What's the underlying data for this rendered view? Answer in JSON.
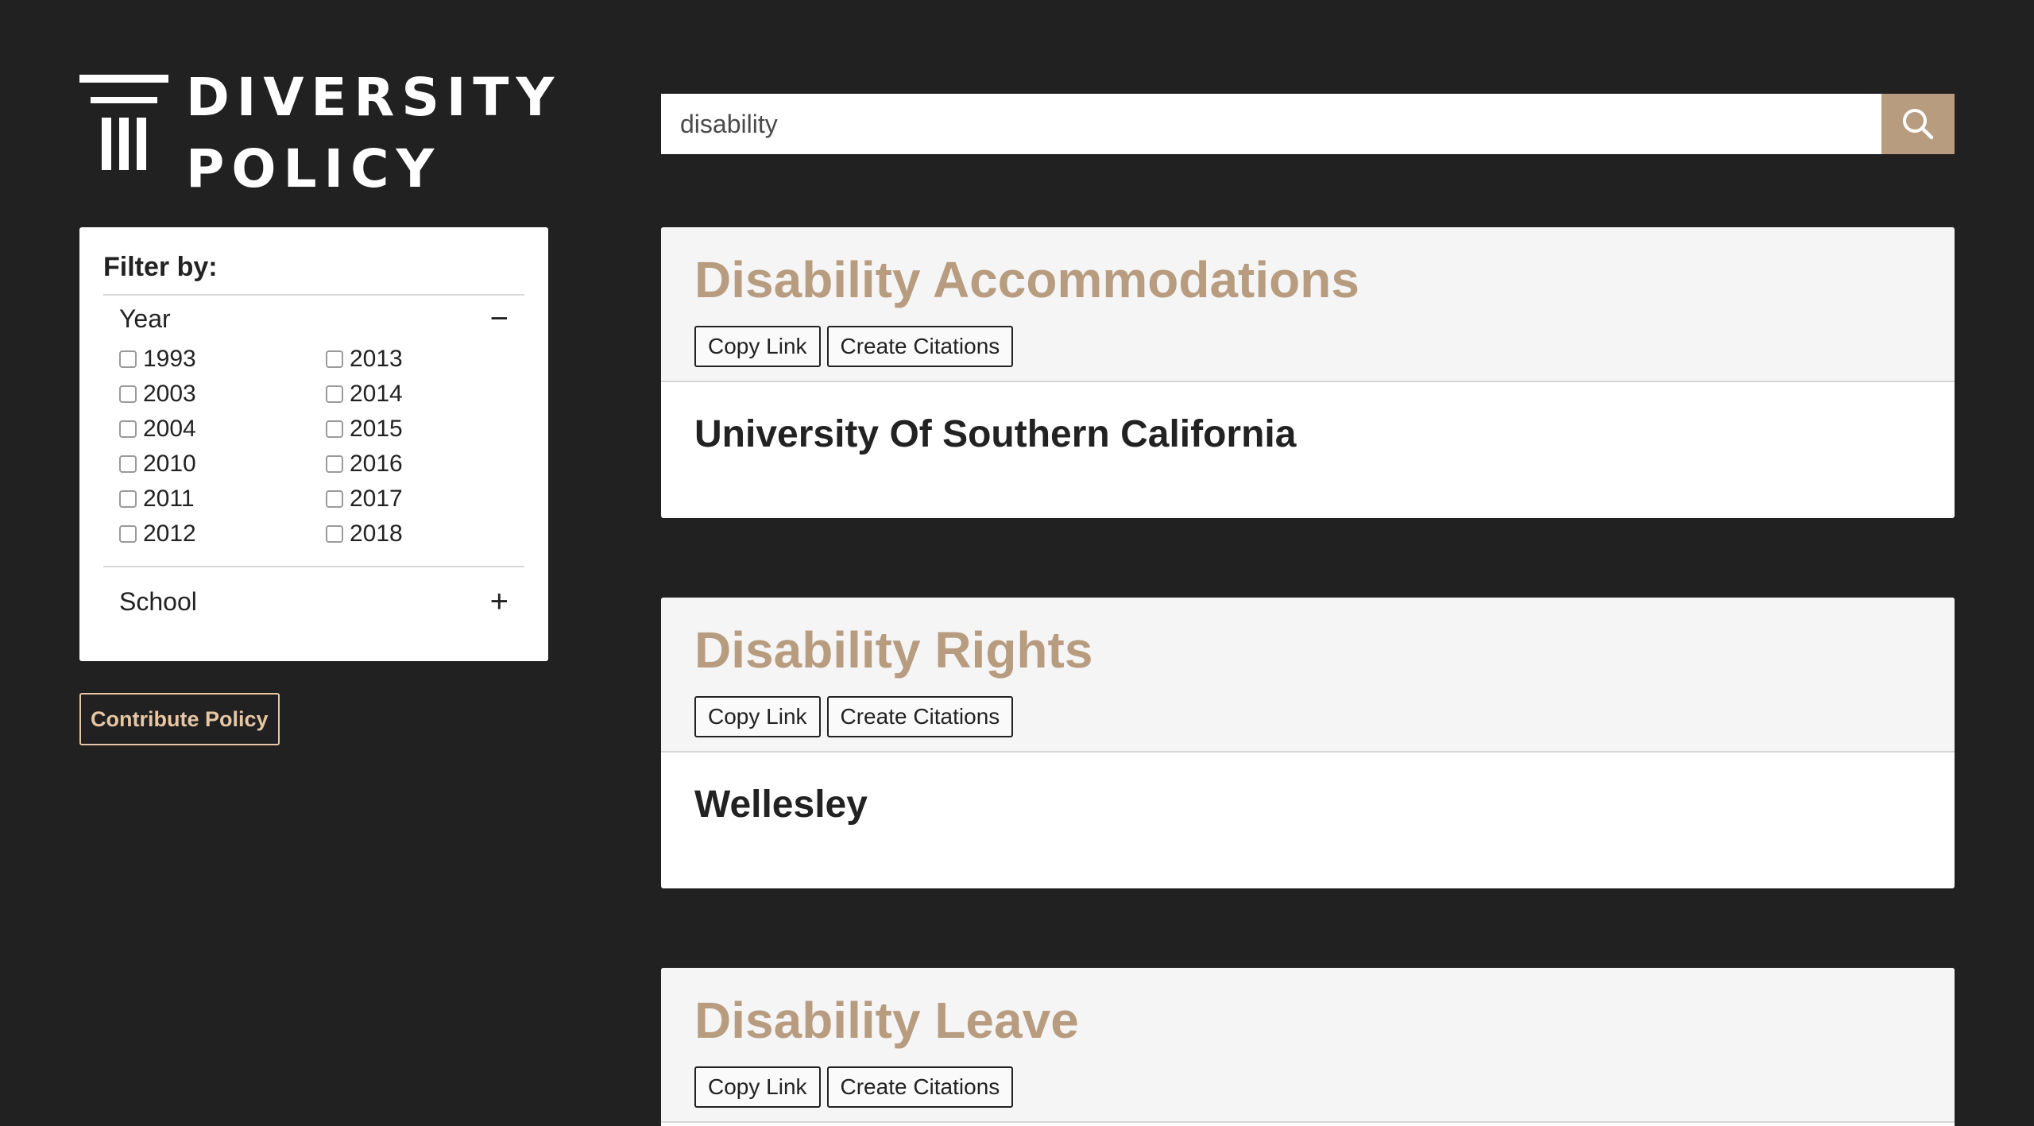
{
  "logo": {
    "line1": "DIVERSITY",
    "line2": "POLICY",
    "icon": "columns-logo-icon"
  },
  "search": {
    "value": "disability",
    "button_icon": "search-icon",
    "button_color": "#b89c80"
  },
  "filter": {
    "title": "Filter by:",
    "sections": {
      "year": {
        "label": "Year",
        "toggle": "−",
        "expanded": true,
        "options": [
          "1993",
          "2013",
          "2003",
          "2014",
          "2004",
          "2015",
          "2010",
          "2016",
          "2011",
          "2017",
          "2012",
          "2018"
        ]
      },
      "school": {
        "label": "School",
        "toggle": "+",
        "expanded": false
      }
    }
  },
  "contribute": {
    "label": "Contribute Policy",
    "color": "#e6c6a3"
  },
  "results": [
    {
      "title": "Disability Accommodations",
      "copy_label": "Copy Link",
      "cite_label": "Create Citations",
      "school": "University Of Southern California"
    },
    {
      "title": "Disability Rights",
      "copy_label": "Copy Link",
      "cite_label": "Create Citations",
      "school": "Wellesley"
    },
    {
      "title": "Disability Leave",
      "copy_label": "Copy Link",
      "cite_label": "Create Citations",
      "school": ""
    }
  ],
  "colors": {
    "background": "#212121",
    "accent": "#b89c80"
  }
}
